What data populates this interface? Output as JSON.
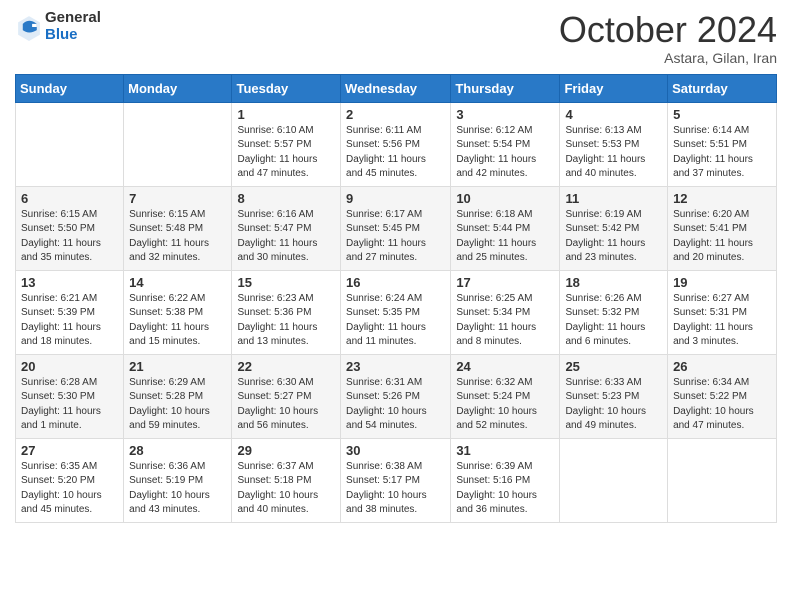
{
  "header": {
    "logo_general": "General",
    "logo_blue": "Blue",
    "title": "October 2024",
    "location": "Astara, Gilan, Iran"
  },
  "weekdays": [
    "Sunday",
    "Monday",
    "Tuesday",
    "Wednesday",
    "Thursday",
    "Friday",
    "Saturday"
  ],
  "weeks": [
    [
      {
        "day": "",
        "info": ""
      },
      {
        "day": "",
        "info": ""
      },
      {
        "day": "1",
        "info": "Sunrise: 6:10 AM\nSunset: 5:57 PM\nDaylight: 11 hours and 47 minutes."
      },
      {
        "day": "2",
        "info": "Sunrise: 6:11 AM\nSunset: 5:56 PM\nDaylight: 11 hours and 45 minutes."
      },
      {
        "day": "3",
        "info": "Sunrise: 6:12 AM\nSunset: 5:54 PM\nDaylight: 11 hours and 42 minutes."
      },
      {
        "day": "4",
        "info": "Sunrise: 6:13 AM\nSunset: 5:53 PM\nDaylight: 11 hours and 40 minutes."
      },
      {
        "day": "5",
        "info": "Sunrise: 6:14 AM\nSunset: 5:51 PM\nDaylight: 11 hours and 37 minutes."
      }
    ],
    [
      {
        "day": "6",
        "info": "Sunrise: 6:15 AM\nSunset: 5:50 PM\nDaylight: 11 hours and 35 minutes."
      },
      {
        "day": "7",
        "info": "Sunrise: 6:15 AM\nSunset: 5:48 PM\nDaylight: 11 hours and 32 minutes."
      },
      {
        "day": "8",
        "info": "Sunrise: 6:16 AM\nSunset: 5:47 PM\nDaylight: 11 hours and 30 minutes."
      },
      {
        "day": "9",
        "info": "Sunrise: 6:17 AM\nSunset: 5:45 PM\nDaylight: 11 hours and 27 minutes."
      },
      {
        "day": "10",
        "info": "Sunrise: 6:18 AM\nSunset: 5:44 PM\nDaylight: 11 hours and 25 minutes."
      },
      {
        "day": "11",
        "info": "Sunrise: 6:19 AM\nSunset: 5:42 PM\nDaylight: 11 hours and 23 minutes."
      },
      {
        "day": "12",
        "info": "Sunrise: 6:20 AM\nSunset: 5:41 PM\nDaylight: 11 hours and 20 minutes."
      }
    ],
    [
      {
        "day": "13",
        "info": "Sunrise: 6:21 AM\nSunset: 5:39 PM\nDaylight: 11 hours and 18 minutes."
      },
      {
        "day": "14",
        "info": "Sunrise: 6:22 AM\nSunset: 5:38 PM\nDaylight: 11 hours and 15 minutes."
      },
      {
        "day": "15",
        "info": "Sunrise: 6:23 AM\nSunset: 5:36 PM\nDaylight: 11 hours and 13 minutes."
      },
      {
        "day": "16",
        "info": "Sunrise: 6:24 AM\nSunset: 5:35 PM\nDaylight: 11 hours and 11 minutes."
      },
      {
        "day": "17",
        "info": "Sunrise: 6:25 AM\nSunset: 5:34 PM\nDaylight: 11 hours and 8 minutes."
      },
      {
        "day": "18",
        "info": "Sunrise: 6:26 AM\nSunset: 5:32 PM\nDaylight: 11 hours and 6 minutes."
      },
      {
        "day": "19",
        "info": "Sunrise: 6:27 AM\nSunset: 5:31 PM\nDaylight: 11 hours and 3 minutes."
      }
    ],
    [
      {
        "day": "20",
        "info": "Sunrise: 6:28 AM\nSunset: 5:30 PM\nDaylight: 11 hours and 1 minute."
      },
      {
        "day": "21",
        "info": "Sunrise: 6:29 AM\nSunset: 5:28 PM\nDaylight: 10 hours and 59 minutes."
      },
      {
        "day": "22",
        "info": "Sunrise: 6:30 AM\nSunset: 5:27 PM\nDaylight: 10 hours and 56 minutes."
      },
      {
        "day": "23",
        "info": "Sunrise: 6:31 AM\nSunset: 5:26 PM\nDaylight: 10 hours and 54 minutes."
      },
      {
        "day": "24",
        "info": "Sunrise: 6:32 AM\nSunset: 5:24 PM\nDaylight: 10 hours and 52 minutes."
      },
      {
        "day": "25",
        "info": "Sunrise: 6:33 AM\nSunset: 5:23 PM\nDaylight: 10 hours and 49 minutes."
      },
      {
        "day": "26",
        "info": "Sunrise: 6:34 AM\nSunset: 5:22 PM\nDaylight: 10 hours and 47 minutes."
      }
    ],
    [
      {
        "day": "27",
        "info": "Sunrise: 6:35 AM\nSunset: 5:20 PM\nDaylight: 10 hours and 45 minutes."
      },
      {
        "day": "28",
        "info": "Sunrise: 6:36 AM\nSunset: 5:19 PM\nDaylight: 10 hours and 43 minutes."
      },
      {
        "day": "29",
        "info": "Sunrise: 6:37 AM\nSunset: 5:18 PM\nDaylight: 10 hours and 40 minutes."
      },
      {
        "day": "30",
        "info": "Sunrise: 6:38 AM\nSunset: 5:17 PM\nDaylight: 10 hours and 38 minutes."
      },
      {
        "day": "31",
        "info": "Sunrise: 6:39 AM\nSunset: 5:16 PM\nDaylight: 10 hours and 36 minutes."
      },
      {
        "day": "",
        "info": ""
      },
      {
        "day": "",
        "info": ""
      }
    ]
  ]
}
